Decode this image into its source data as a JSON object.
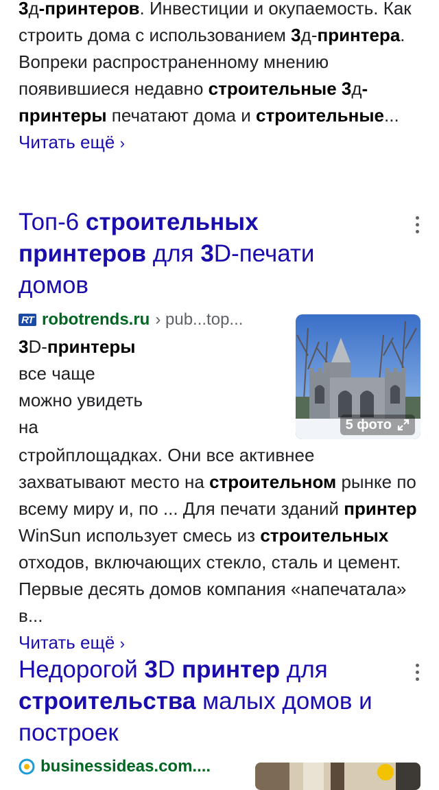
{
  "result1": {
    "snippet_parts": [
      {
        "b": true,
        "t": "3"
      },
      {
        "b": false,
        "t": "д"
      },
      {
        "b": true,
        "t": "-принтеров"
      },
      {
        "b": false,
        "t": ". Инвестиции и окупаемость. Как строить дома с использованием "
      },
      {
        "b": true,
        "t": "3"
      },
      {
        "b": false,
        "t": "д"
      },
      {
        "b": false,
        "t": "-"
      },
      {
        "b": true,
        "t": "принтера"
      },
      {
        "b": false,
        "t": ". Вопреки распространенному мнению появившиеся недавно "
      },
      {
        "b": true,
        "t": "строительные"
      },
      {
        "b": false,
        "t": " "
      },
      {
        "b": true,
        "t": "3"
      },
      {
        "b": false,
        "t": "д"
      },
      {
        "b": true,
        "t": "-принтеры"
      },
      {
        "b": false,
        "t": " печатают дома и "
      },
      {
        "b": true,
        "t": "строительные"
      },
      {
        "b": false,
        "t": "... "
      }
    ],
    "read_more": "Читать ещё"
  },
  "result2": {
    "title_parts": [
      {
        "b": false,
        "t": "Топ-6 "
      },
      {
        "b": true,
        "t": "строительных принтеров"
      },
      {
        "b": false,
        "t": " для "
      },
      {
        "b": true,
        "t": "3"
      },
      {
        "b": false,
        "t": "D-печати домов"
      }
    ],
    "site": {
      "domain": "robotrends.ru",
      "path": "› pub...top...",
      "favicon_text": "RT"
    },
    "image": {
      "badge": "5 фото"
    },
    "snippet_parts": [
      {
        "b": true,
        "t": "3"
      },
      {
        "b": false,
        "t": "D-"
      },
      {
        "b": true,
        "t": "принтеры"
      },
      {
        "b": false,
        "t": " все чаще можно увидеть на стройплощадках. Они все активнее захватывают место на "
      },
      {
        "b": true,
        "t": "строительном"
      },
      {
        "b": false,
        "t": " рынке по всему миру и, по ... Для печати зданий "
      },
      {
        "b": true,
        "t": "принтер"
      },
      {
        "b": false,
        "t": " WinSun использует смесь из "
      },
      {
        "b": true,
        "t": "строительных"
      },
      {
        "b": false,
        "t": " отходов, включающих стекло, сталь и цемент. Первые десять домов компания «напечатала» в..."
      }
    ],
    "read_more": "Читать ещё"
  },
  "result3": {
    "title_parts": [
      {
        "b": false,
        "t": "Недорогой "
      },
      {
        "b": true,
        "t": "3"
      },
      {
        "b": false,
        "t": "D "
      },
      {
        "b": true,
        "t": "принтер"
      },
      {
        "b": false,
        "t": " для "
      },
      {
        "b": true,
        "t": "строительства"
      },
      {
        "b": false,
        "t": " малых домов и построек"
      }
    ],
    "site": {
      "domain": "businessideas.com...."
    }
  },
  "icons": {
    "more_options": "kebab-icon",
    "chevron": "chevron-right-icon",
    "expand": "expand-icon"
  },
  "colors": {
    "link": "#1a0dab",
    "site": "#006621",
    "text": "#202124"
  }
}
